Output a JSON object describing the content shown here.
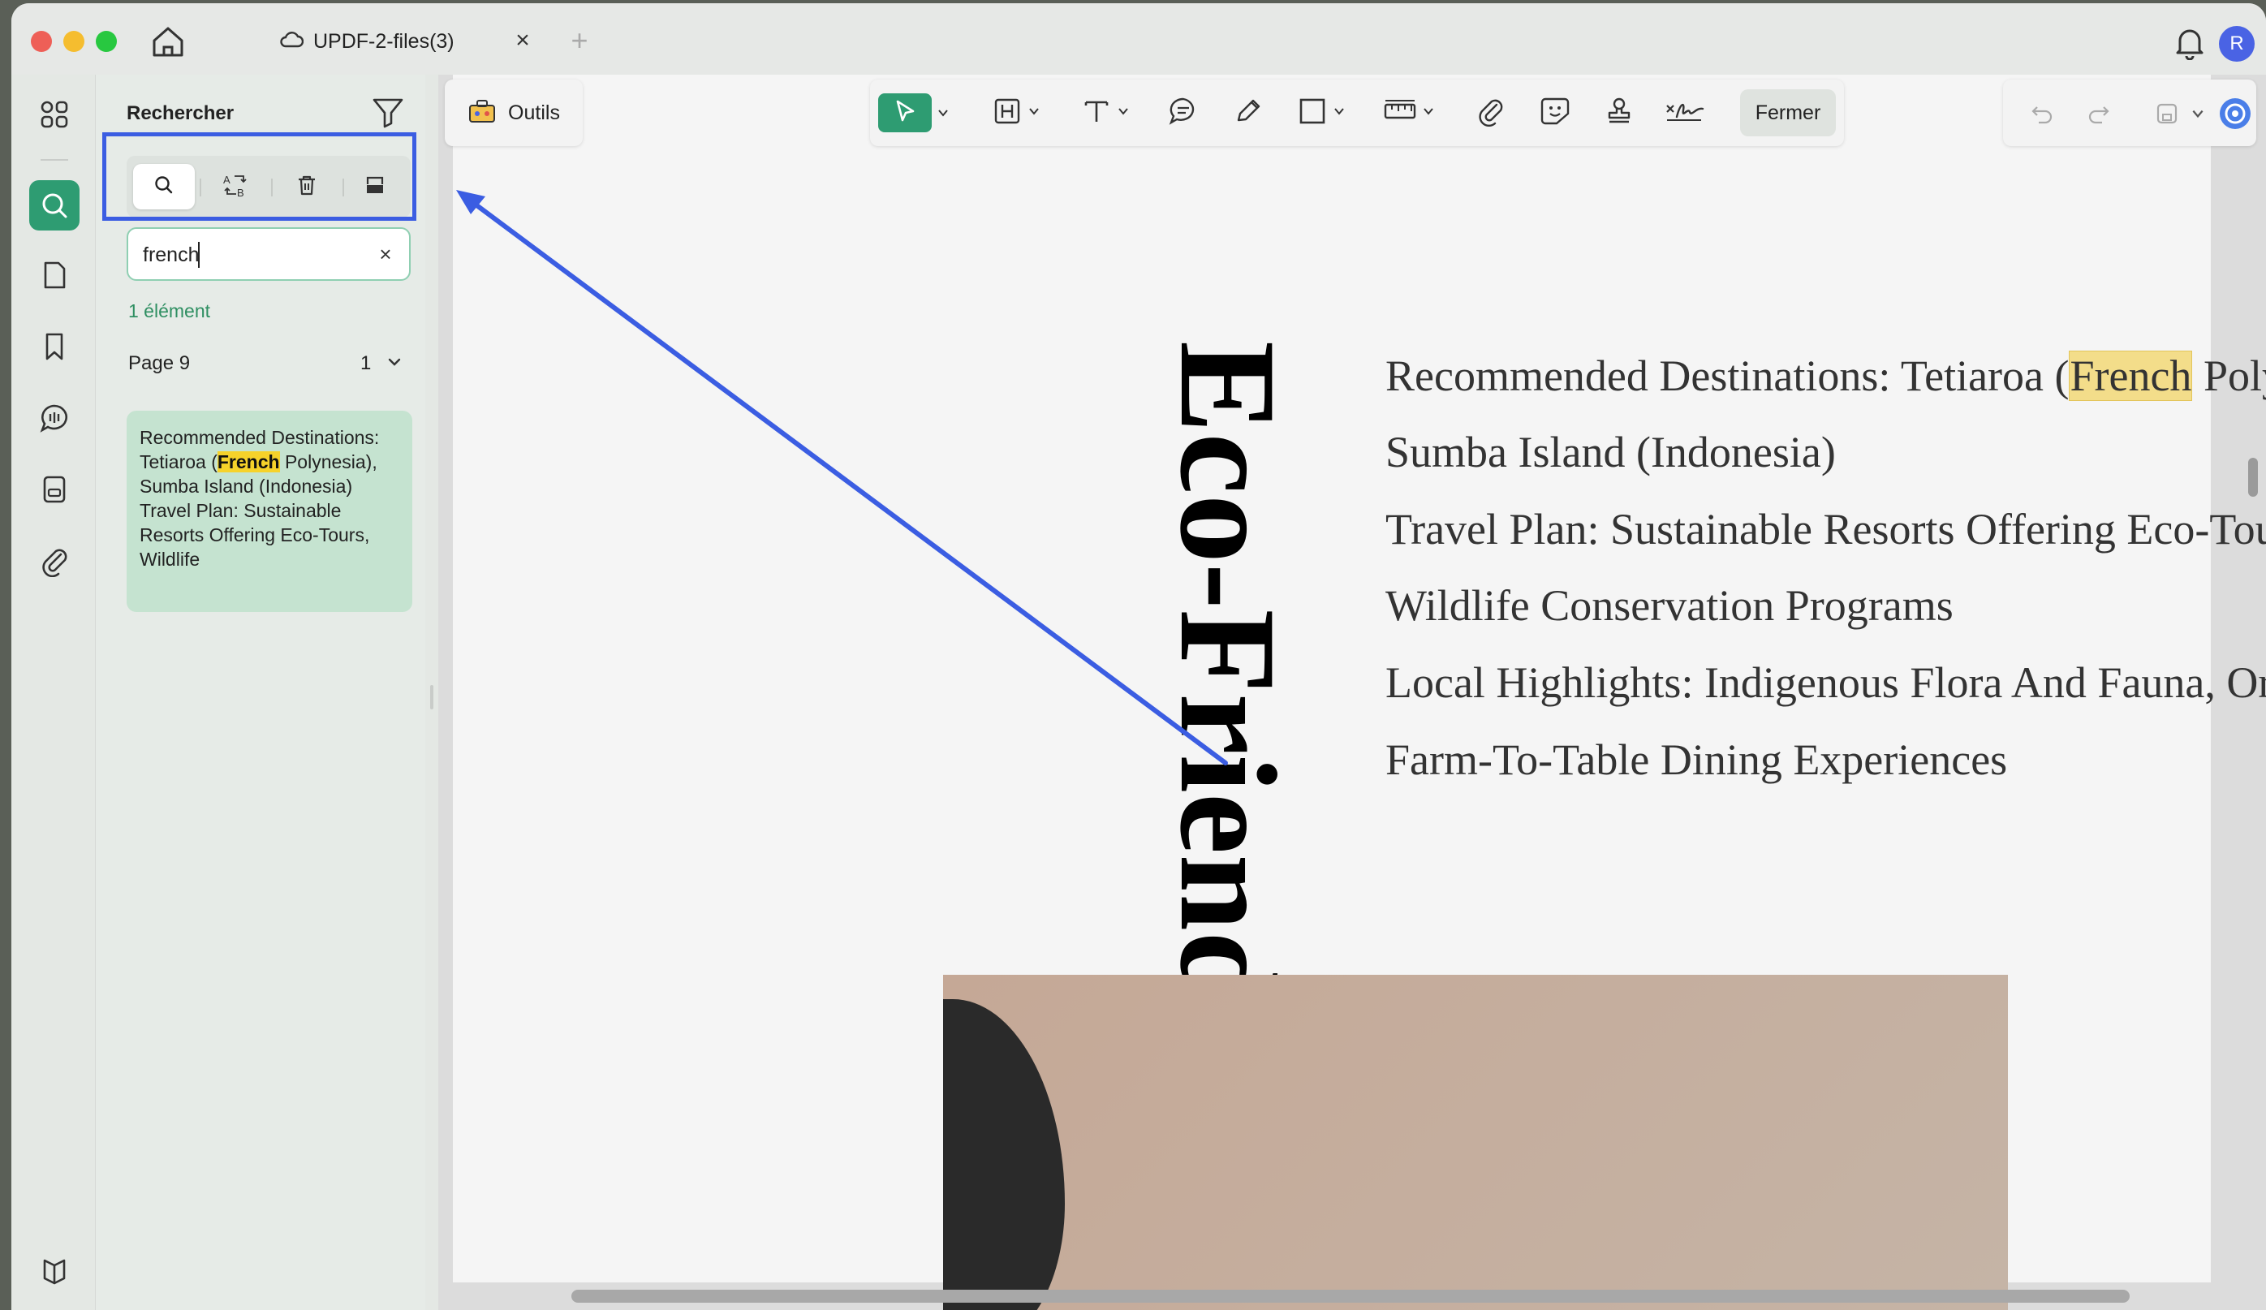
{
  "titlebar": {
    "tab_title": "UPDF-2-files(3)",
    "tab_close": "×",
    "tab_add": "+",
    "avatar_initial": "R"
  },
  "rail": {
    "items": [
      "thumbnails-icon",
      "search-icon",
      "page-icon",
      "bookmark-icon",
      "comment-icon",
      "form-icon",
      "attachment-icon",
      "layers-icon"
    ]
  },
  "search_panel": {
    "title": "Rechercher",
    "modes": [
      "search",
      "replace",
      "remove",
      "redact"
    ],
    "query": "french",
    "clear": "×",
    "result_count": "1 élément",
    "page_label": "Page 9",
    "page_hits": "1",
    "result": {
      "before": "Recommended Destinations: Tetiaroa (",
      "match": "French",
      "after": " Polynesia), Sumba Island (Indonesia) Travel Plan: Sustainable Resorts Offering Eco-Tours, Wildlife"
    }
  },
  "toolbar": {
    "outils_label": "Outils",
    "fermer_label": "Fermer"
  },
  "document": {
    "vertical_title": "Eco-Friendly I",
    "lines": [
      {
        "before": "Recommended Destinations: Tetiaroa (",
        "match": "French",
        "after": " Polynesia),"
      },
      {
        "text": "Sumba Island (Indonesia)"
      },
      {
        "text": "Travel Plan: Sustainable Resorts Offering Eco-Tours,"
      },
      {
        "text": "Wildlife Conservation Programs"
      },
      {
        "text": "Local Highlights: Indigenous Flora And Fauna, Organic"
      },
      {
        "text": "Farm-To-Table Dining Experiences"
      }
    ]
  },
  "colors": {
    "accent": "#2e9c72",
    "annotation": "#3b5de2",
    "match_highlight": "#f6d22a"
  }
}
